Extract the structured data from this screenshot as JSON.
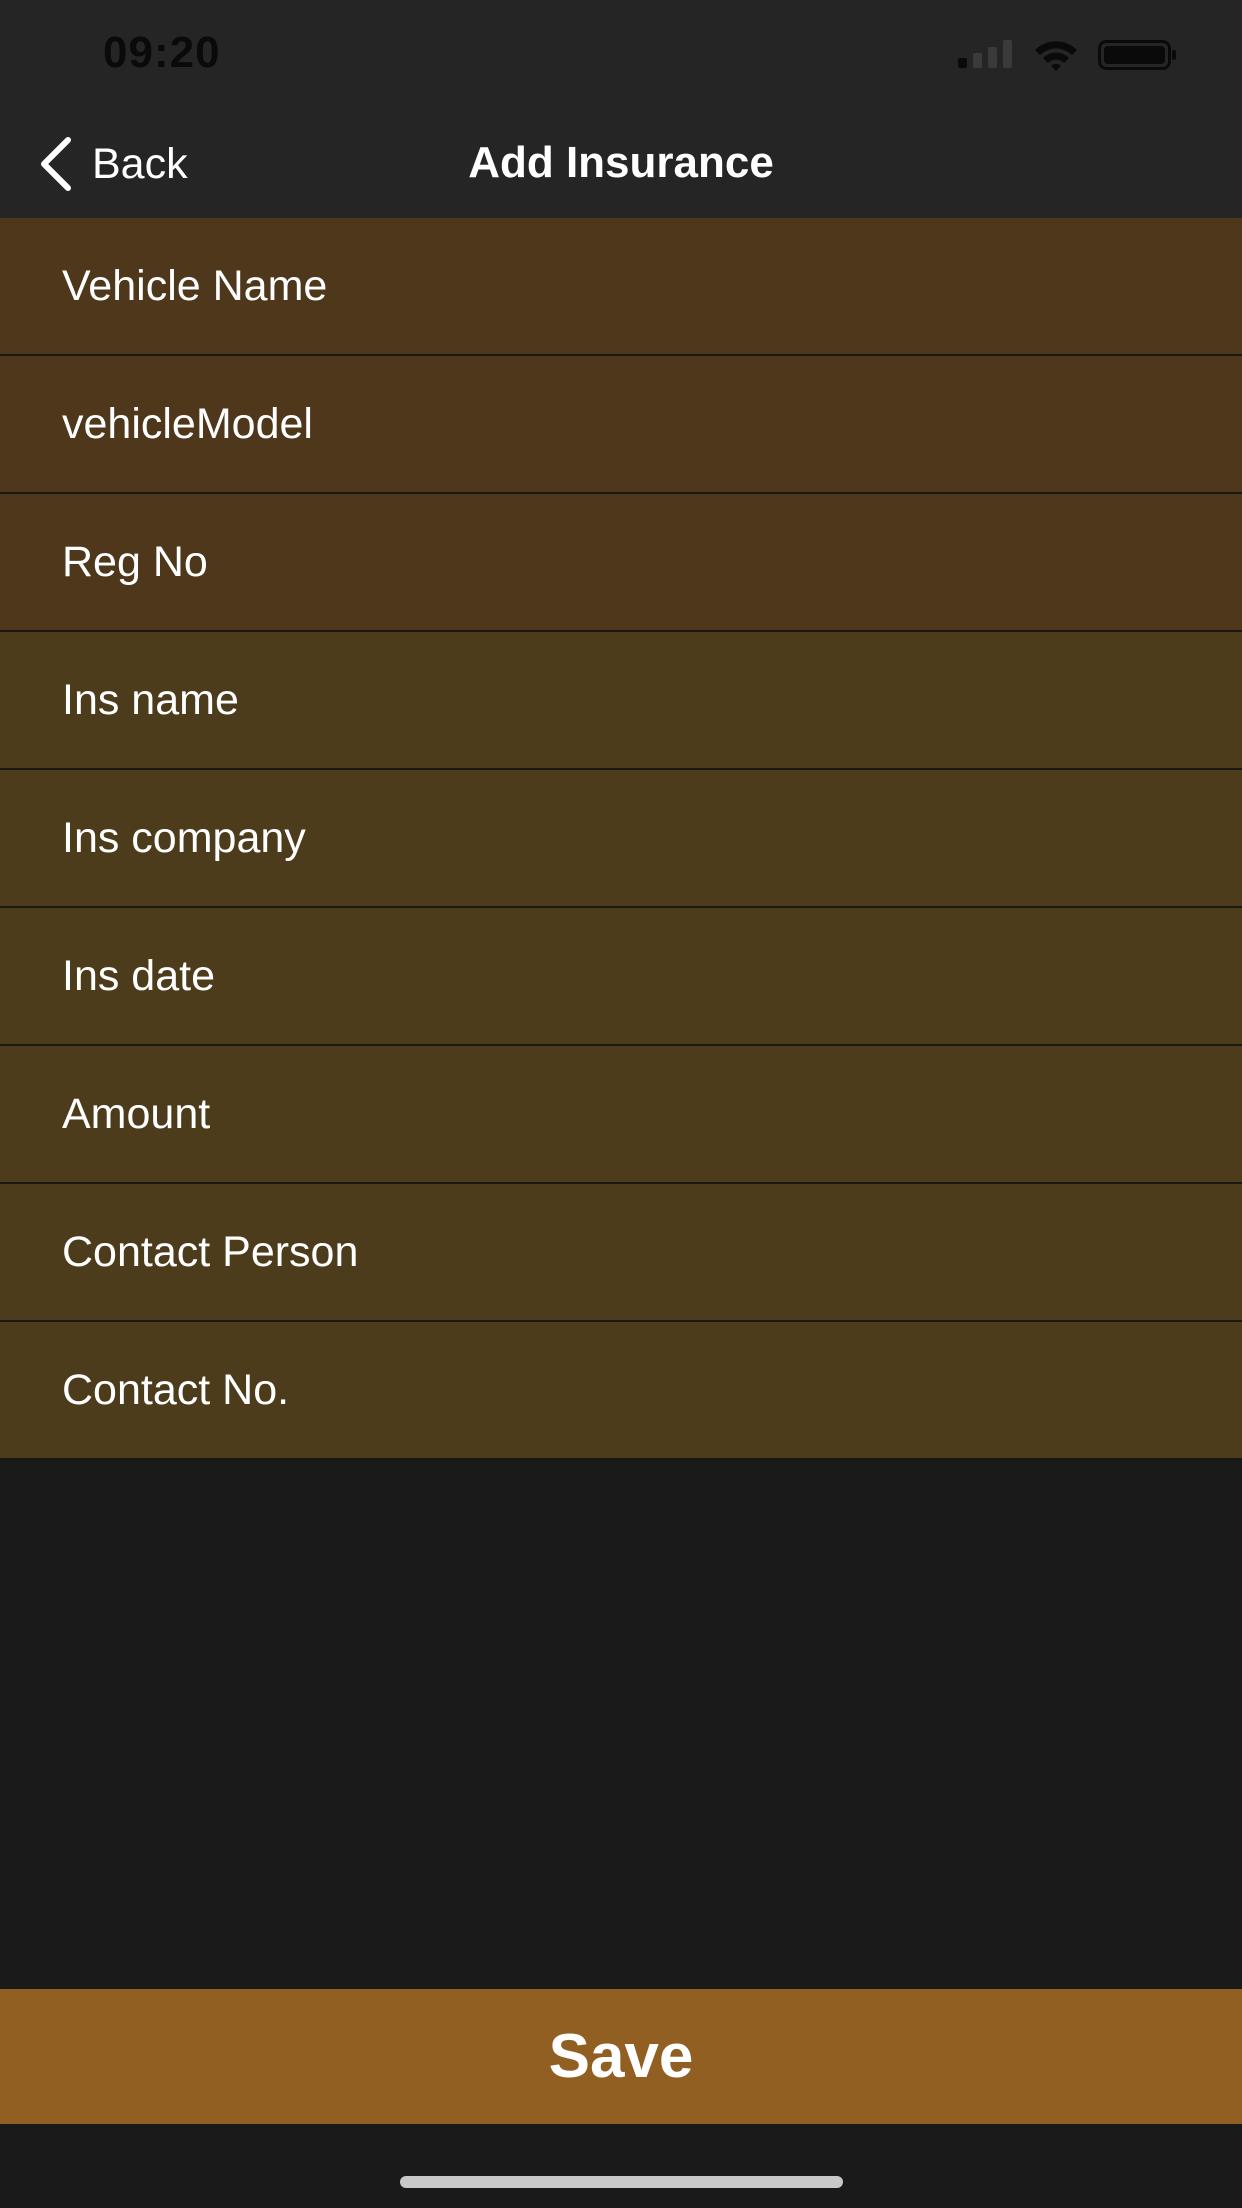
{
  "status_bar": {
    "time": "09:20",
    "icons": [
      "cellular-signal-icon",
      "wifi-icon",
      "battery-icon"
    ]
  },
  "nav": {
    "back_label": "Back",
    "title": "Add Insurance"
  },
  "form": {
    "fields": [
      {
        "placeholder": "Vehicle Name",
        "value": ""
      },
      {
        "placeholder": "vehicleModel",
        "value": ""
      },
      {
        "placeholder": "Reg No",
        "value": ""
      },
      {
        "placeholder": "Ins name",
        "value": ""
      },
      {
        "placeholder": "Ins company",
        "value": ""
      },
      {
        "placeholder": "Ins date",
        "value": ""
      },
      {
        "placeholder": "Amount",
        "value": ""
      },
      {
        "placeholder": "Contact Person",
        "value": ""
      },
      {
        "placeholder": "Contact No.",
        "value": ""
      }
    ]
  },
  "actions": {
    "save_label": "Save"
  },
  "colors": {
    "bar_background": "#252525",
    "screen_background": "#1a1a1a",
    "vehicle_field_background": "#4e371b",
    "insurance_field_background": "#4d3c1b",
    "save_button": "#925f22",
    "text": "#ffffff"
  }
}
